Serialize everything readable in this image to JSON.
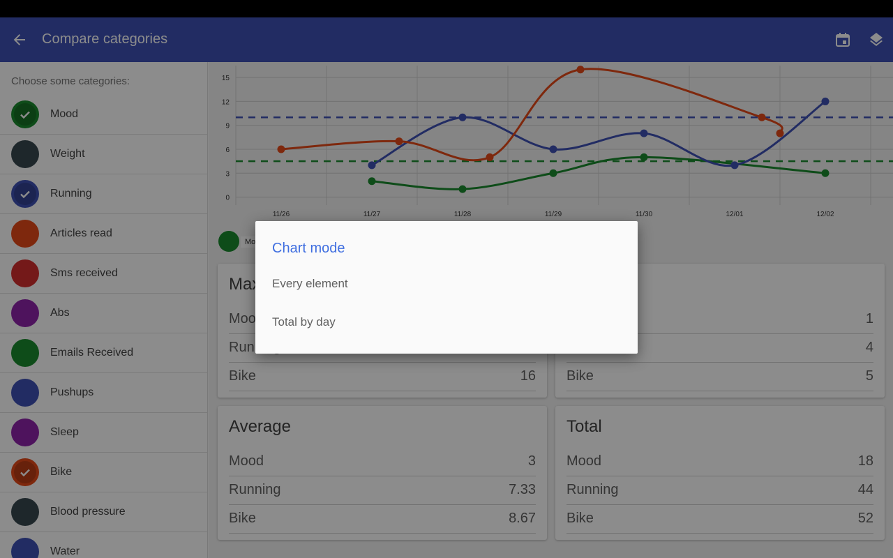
{
  "toolbar": {
    "title": "Compare categories",
    "back_icon": "arrow-back-icon",
    "actions": [
      {
        "icon": "calendar-icon"
      },
      {
        "icon": "layers-icon"
      }
    ],
    "color": "#3f51b5"
  },
  "sidebar": {
    "prompt": "Choose some categories:",
    "items": [
      {
        "label": "Mood",
        "color": "#1b8a2e",
        "checked": true
      },
      {
        "label": "Weight",
        "color": "#37474f",
        "checked": false
      },
      {
        "label": "Running",
        "color": "#3f51b5",
        "checked": true
      },
      {
        "label": "Articles read",
        "color": "#e64a19",
        "checked": false
      },
      {
        "label": "Sms received",
        "color": "#d32f2f",
        "checked": false
      },
      {
        "label": "Abs",
        "color": "#8e24aa",
        "checked": false
      },
      {
        "label": "Emails Received",
        "color": "#1b8a2e",
        "checked": false
      },
      {
        "label": "Pushups",
        "color": "#3f51b5",
        "checked": false
      },
      {
        "label": "Sleep",
        "color": "#8e24aa",
        "checked": false
      },
      {
        "label": "Bike",
        "color": "#e64a19",
        "checked": true
      },
      {
        "label": "Blood pressure",
        "color": "#37474f",
        "checked": false
      },
      {
        "label": "Water",
        "color": "#3f51b5",
        "checked": false
      }
    ]
  },
  "legend": {
    "label": "Moo"
  },
  "chart_data": {
    "type": "line",
    "x": [
      "11/26",
      "11/27",
      "11/28",
      "11/29",
      "11/30",
      "12/01",
      "12/02"
    ],
    "y_ticks": [
      0,
      3,
      6,
      9,
      12,
      15
    ],
    "ylim": [
      -1,
      16.5
    ],
    "series": [
      {
        "name": "Mood",
        "color": "#1b8a2e",
        "points": [
          [
            1.5,
            2
          ],
          [
            2.5,
            1
          ],
          [
            3.5,
            3
          ],
          [
            4.5,
            5
          ],
          [
            6.5,
            3
          ]
        ]
      },
      {
        "name": "Running",
        "color": "#3f51b5",
        "points": [
          [
            1.5,
            4
          ],
          [
            2.5,
            10
          ],
          [
            3.5,
            6
          ],
          [
            4.5,
            8
          ],
          [
            5.5,
            4
          ],
          [
            6.5,
            12
          ]
        ]
      },
      {
        "name": "Bike",
        "color": "#e64a19",
        "points": [
          [
            0.5,
            6
          ],
          [
            1.8,
            7
          ],
          [
            2.8,
            5
          ],
          [
            3.8,
            16
          ],
          [
            5.8,
            10
          ],
          [
            6.0,
            8
          ]
        ]
      }
    ],
    "averages": [
      {
        "series": "Running",
        "value": 10,
        "color": "#3f51b5"
      },
      {
        "series": "Mood",
        "value": 4.5,
        "color": "#1b8a2e"
      }
    ]
  },
  "cards": {
    "max": {
      "title": "Max",
      "rows": [
        {
          "label": "Mood",
          "value": ""
        },
        {
          "label": "Running",
          "value": ""
        },
        {
          "label": "Bike",
          "value": "16"
        }
      ]
    },
    "min": {
      "title": "",
      "rows": [
        {
          "label": "",
          "value": "1"
        },
        {
          "label": "",
          "value": "4"
        },
        {
          "label": "Bike",
          "value": "5"
        }
      ]
    },
    "average": {
      "title": "Average",
      "rows": [
        {
          "label": "Mood",
          "value": "3"
        },
        {
          "label": "Running",
          "value": "7.33"
        },
        {
          "label": "Bike",
          "value": "8.67"
        }
      ]
    },
    "total": {
      "title": "Total",
      "rows": [
        {
          "label": "Mood",
          "value": "18"
        },
        {
          "label": "Running",
          "value": "44"
        },
        {
          "label": "Bike",
          "value": "52"
        }
      ]
    }
  },
  "dialog": {
    "title": "Chart mode",
    "options": [
      "Every element",
      "Total by day"
    ]
  }
}
